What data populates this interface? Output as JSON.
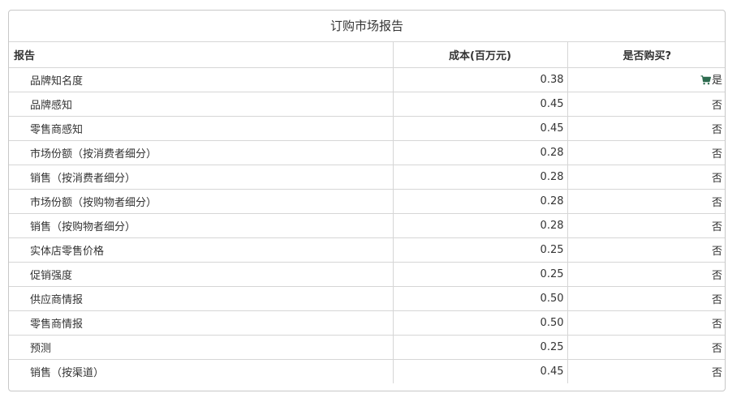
{
  "panel": {
    "title": "订购市场报告"
  },
  "table": {
    "headers": {
      "report": "报告",
      "cost": "成本(百万元)",
      "purchase": "是否购买?"
    },
    "rows": [
      {
        "name": "品牌知名度",
        "cost": "0.38",
        "purchase": "是",
        "icon": "shopping-cart-icon"
      },
      {
        "name": "品牌感知",
        "cost": "0.45",
        "purchase": "否"
      },
      {
        "name": "零售商感知",
        "cost": "0.45",
        "purchase": "否"
      },
      {
        "name": "市场份额（按消费者细分）",
        "cost": "0.28",
        "purchase": "否"
      },
      {
        "name": "销售（按消费者细分）",
        "cost": "0.28",
        "purchase": "否"
      },
      {
        "name": "市场份额（按购物者细分）",
        "cost": "0.28",
        "purchase": "否"
      },
      {
        "name": "销售（按购物者细分）",
        "cost": "0.28",
        "purchase": "否"
      },
      {
        "name": "实体店零售价格",
        "cost": "0.25",
        "purchase": "否"
      },
      {
        "name": "促销强度",
        "cost": "0.25",
        "purchase": "否"
      },
      {
        "name": "供应商情报",
        "cost": "0.50",
        "purchase": "否"
      },
      {
        "name": "零售商情报",
        "cost": "0.50",
        "purchase": "否"
      },
      {
        "name": "预测",
        "cost": "0.25",
        "purchase": "否"
      },
      {
        "name": "销售（按渠道）",
        "cost": "0.45",
        "purchase": "否"
      }
    ]
  },
  "colors": {
    "border": "#d6d6d6",
    "panel_border": "#c8c8c8",
    "cart": "#2d6b4f"
  }
}
